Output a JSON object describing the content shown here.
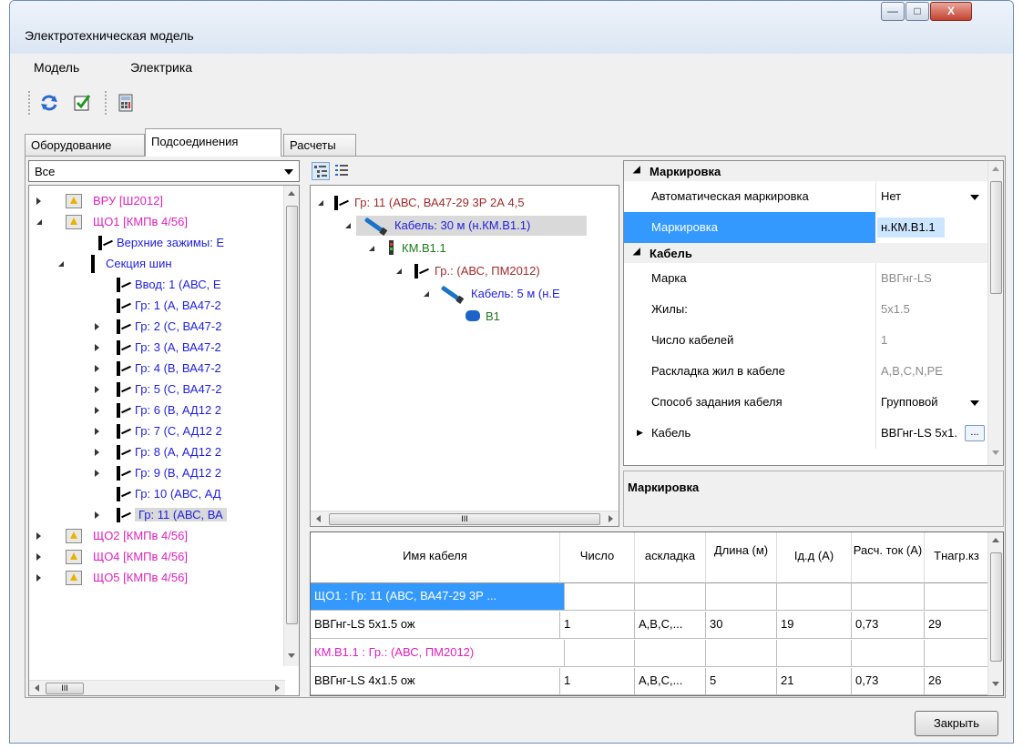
{
  "window": {
    "title": "Электротехническая модель",
    "controls": {
      "minimize": "—",
      "maximize": "□",
      "close": "X"
    }
  },
  "menu": [
    "Модель",
    "Электрика"
  ],
  "toolbar": {
    "icons": [
      "refresh-icon",
      "checkbox-check-icon",
      "calculator-icon"
    ]
  },
  "tabs": [
    {
      "label": "Оборудование",
      "active": false
    },
    {
      "label": "Подсоединения",
      "active": true
    },
    {
      "label": "Расчеты",
      "active": false
    }
  ],
  "filter": {
    "value": "Все"
  },
  "left_tree": [
    {
      "text": "ВРУ [Ш2012]",
      "color": "pink"
    },
    {
      "text": "ЩО1 [КМПв 4/56]",
      "color": "pink"
    },
    {
      "text": "Верхние зажимы: Е",
      "color": "blue"
    },
    {
      "text": "Секция шин",
      "color": "blue"
    },
    {
      "text": "Ввод: 1 (АВС, Е",
      "color": "blue"
    },
    {
      "text": "Гр: 1 (А, ВА47-2",
      "color": "blue"
    },
    {
      "text": "Гр: 2 (С, ВА47-2",
      "color": "blue"
    },
    {
      "text": "Гр: 3 (А, ВА47-2",
      "color": "blue"
    },
    {
      "text": "Гр: 4 (В, ВА47-2",
      "color": "blue"
    },
    {
      "text": "Гр: 5 (С, ВА47-2",
      "color": "blue"
    },
    {
      "text": "Гр: 6 (В, АД12 2",
      "color": "blue"
    },
    {
      "text": "Гр: 7 (С, АД12 2",
      "color": "blue"
    },
    {
      "text": "Гр: 8 (А, АД12 2",
      "color": "blue"
    },
    {
      "text": "Гр: 9 (В, АД12 2",
      "color": "blue"
    },
    {
      "text": "Гр: 10 (АВС, АД",
      "color": "blue"
    },
    {
      "text": "Гр: 11 (АВС, ВА",
      "color": "blue"
    },
    {
      "text": "ЩО2 [КМПв 4/56]",
      "color": "pink"
    },
    {
      "text": "ЩО4 [КМПв 4/56]",
      "color": "pink"
    },
    {
      "text": "ЩО5 [КМПв 4/56]",
      "color": "pink"
    }
  ],
  "mid_tree": [
    {
      "text": "Гр: 11 (АВС, ВА47-29 3Р  2А 4,5",
      "color": "maroon"
    },
    {
      "text": "Кабель: 30 м (н.КМ.В1.1)",
      "color": "blue"
    },
    {
      "text": "КМ.В1.1",
      "color": "green"
    },
    {
      "text": "Гр.: (АВС, ПМ2012)",
      "color": "maroon"
    },
    {
      "text": "Кабель: 5 м (н.Е",
      "color": "blue"
    },
    {
      "text": "В1",
      "color": "green"
    }
  ],
  "properties": {
    "cat_marking": "Маркировка",
    "auto_marking_name": "Автоматическая маркировка",
    "auto_marking_value": "Нет",
    "marking_name": "Маркировка",
    "marking_value": "н.КМ.В1.1",
    "cat_cable": "Кабель",
    "brand_name": "Марка",
    "brand_value": "ВВГнг-LS",
    "cores_name": "Жилы:",
    "cores_value": "5x1.5",
    "count_name": "Число кабелей",
    "count_value": "1",
    "layout_name": "Раскладка жил в кабеле",
    "layout_value": "A,B,C,N,PE",
    "method_name": "Способ задания кабеля",
    "method_value": "Групповой",
    "cable_name": "Кабель",
    "cable_value": "ВВГнг-LS 5x1.",
    "ellipsis": "...",
    "description_title": "Маркировка"
  },
  "grid": {
    "headers": [
      "Имя кабеля",
      "Число",
      "аскладка",
      "Длина (м)",
      "Iд.д (А)",
      "Расч. ток (А)",
      "Тнагр.кз"
    ],
    "rows": [
      {
        "cells": [
          "ЩО1 : Гр: 11 (АВС, ВА47-29 3Р ...",
          "",
          "",
          "",
          "",
          "",
          ""
        ],
        "style": "selected"
      },
      {
        "cells": [
          "ВВГнг-LS 5x1.5 ож",
          "1",
          "A,B,C,...",
          "30",
          "19",
          "0,73",
          "29"
        ],
        "style": "normal"
      },
      {
        "cells": [
          "КМ.В1.1 : Гр.:  (АВС, ПМ2012)",
          "",
          "",
          "",
          "",
          "",
          ""
        ],
        "style": "pink"
      },
      {
        "cells": [
          "ВВГнг-LS 4x1.5 ож",
          "1",
          "A,B,C,...",
          "5",
          "21",
          "0,73",
          "26"
        ],
        "style": "normal"
      }
    ]
  },
  "scroll_glyph": "III",
  "close_button": "Закрыть",
  "colors": {
    "selection": "#3399ff",
    "highlight_value_bg": "#cde6ff",
    "pink": "#e020c0",
    "blue": "#1f1fe0",
    "maroon": "#a52a2a",
    "green": "#1a7a1a"
  }
}
